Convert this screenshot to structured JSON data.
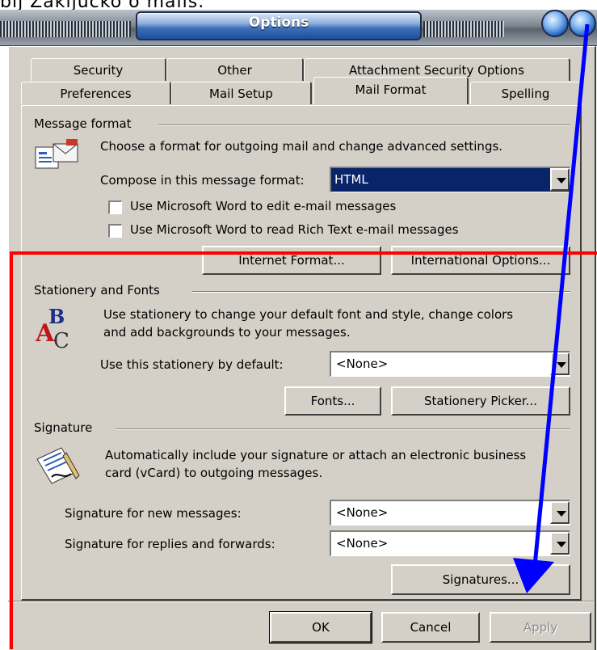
{
  "caption": "bij Zaključko o mails.",
  "window": {
    "title": "Options"
  },
  "tabs_row1": [
    "Security",
    "Other",
    "Attachment Security Options"
  ],
  "tabs_row2": [
    "Preferences",
    "Mail Setup",
    "Mail Format",
    "Spelling"
  ],
  "active_tab": "Mail Format",
  "message_format": {
    "title": "Message format",
    "description": "Choose a format for outgoing mail and change advanced settings.",
    "compose_label": "Compose in this message format:",
    "compose_value": "HTML",
    "use_word_edit": {
      "label": "Use Microsoft Word to edit e-mail messages",
      "checked": false
    },
    "use_word_read": {
      "label": "Use Microsoft Word to read Rich Text e-mail messages",
      "checked": false
    },
    "internet_format_button": "Internet Format...",
    "international_options_button": "International Options..."
  },
  "stationery": {
    "title": "Stationery and Fonts",
    "description_line1": "Use stationery to change your default font and style, change colors",
    "description_line2": "and add backgrounds to your messages.",
    "default_label": "Use this stationery by default:",
    "default_value": "<None>",
    "fonts_button": "Fonts...",
    "picker_button": "Stationery Picker..."
  },
  "signature": {
    "title": "Signature",
    "description_line1": "Automatically include your signature or attach an electronic business",
    "description_line2": "card (vCard) to outgoing messages.",
    "new_label": "Signature for new messages:",
    "new_value": "<None>",
    "reply_label": "Signature for replies and forwards:",
    "reply_value": "<None>",
    "signatures_button": "Signatures..."
  },
  "footer": {
    "ok": "OK",
    "cancel": "Cancel",
    "apply": "Apply"
  },
  "annotation_colors": {
    "box": "#ff0000",
    "arrow": "#0000ff"
  }
}
